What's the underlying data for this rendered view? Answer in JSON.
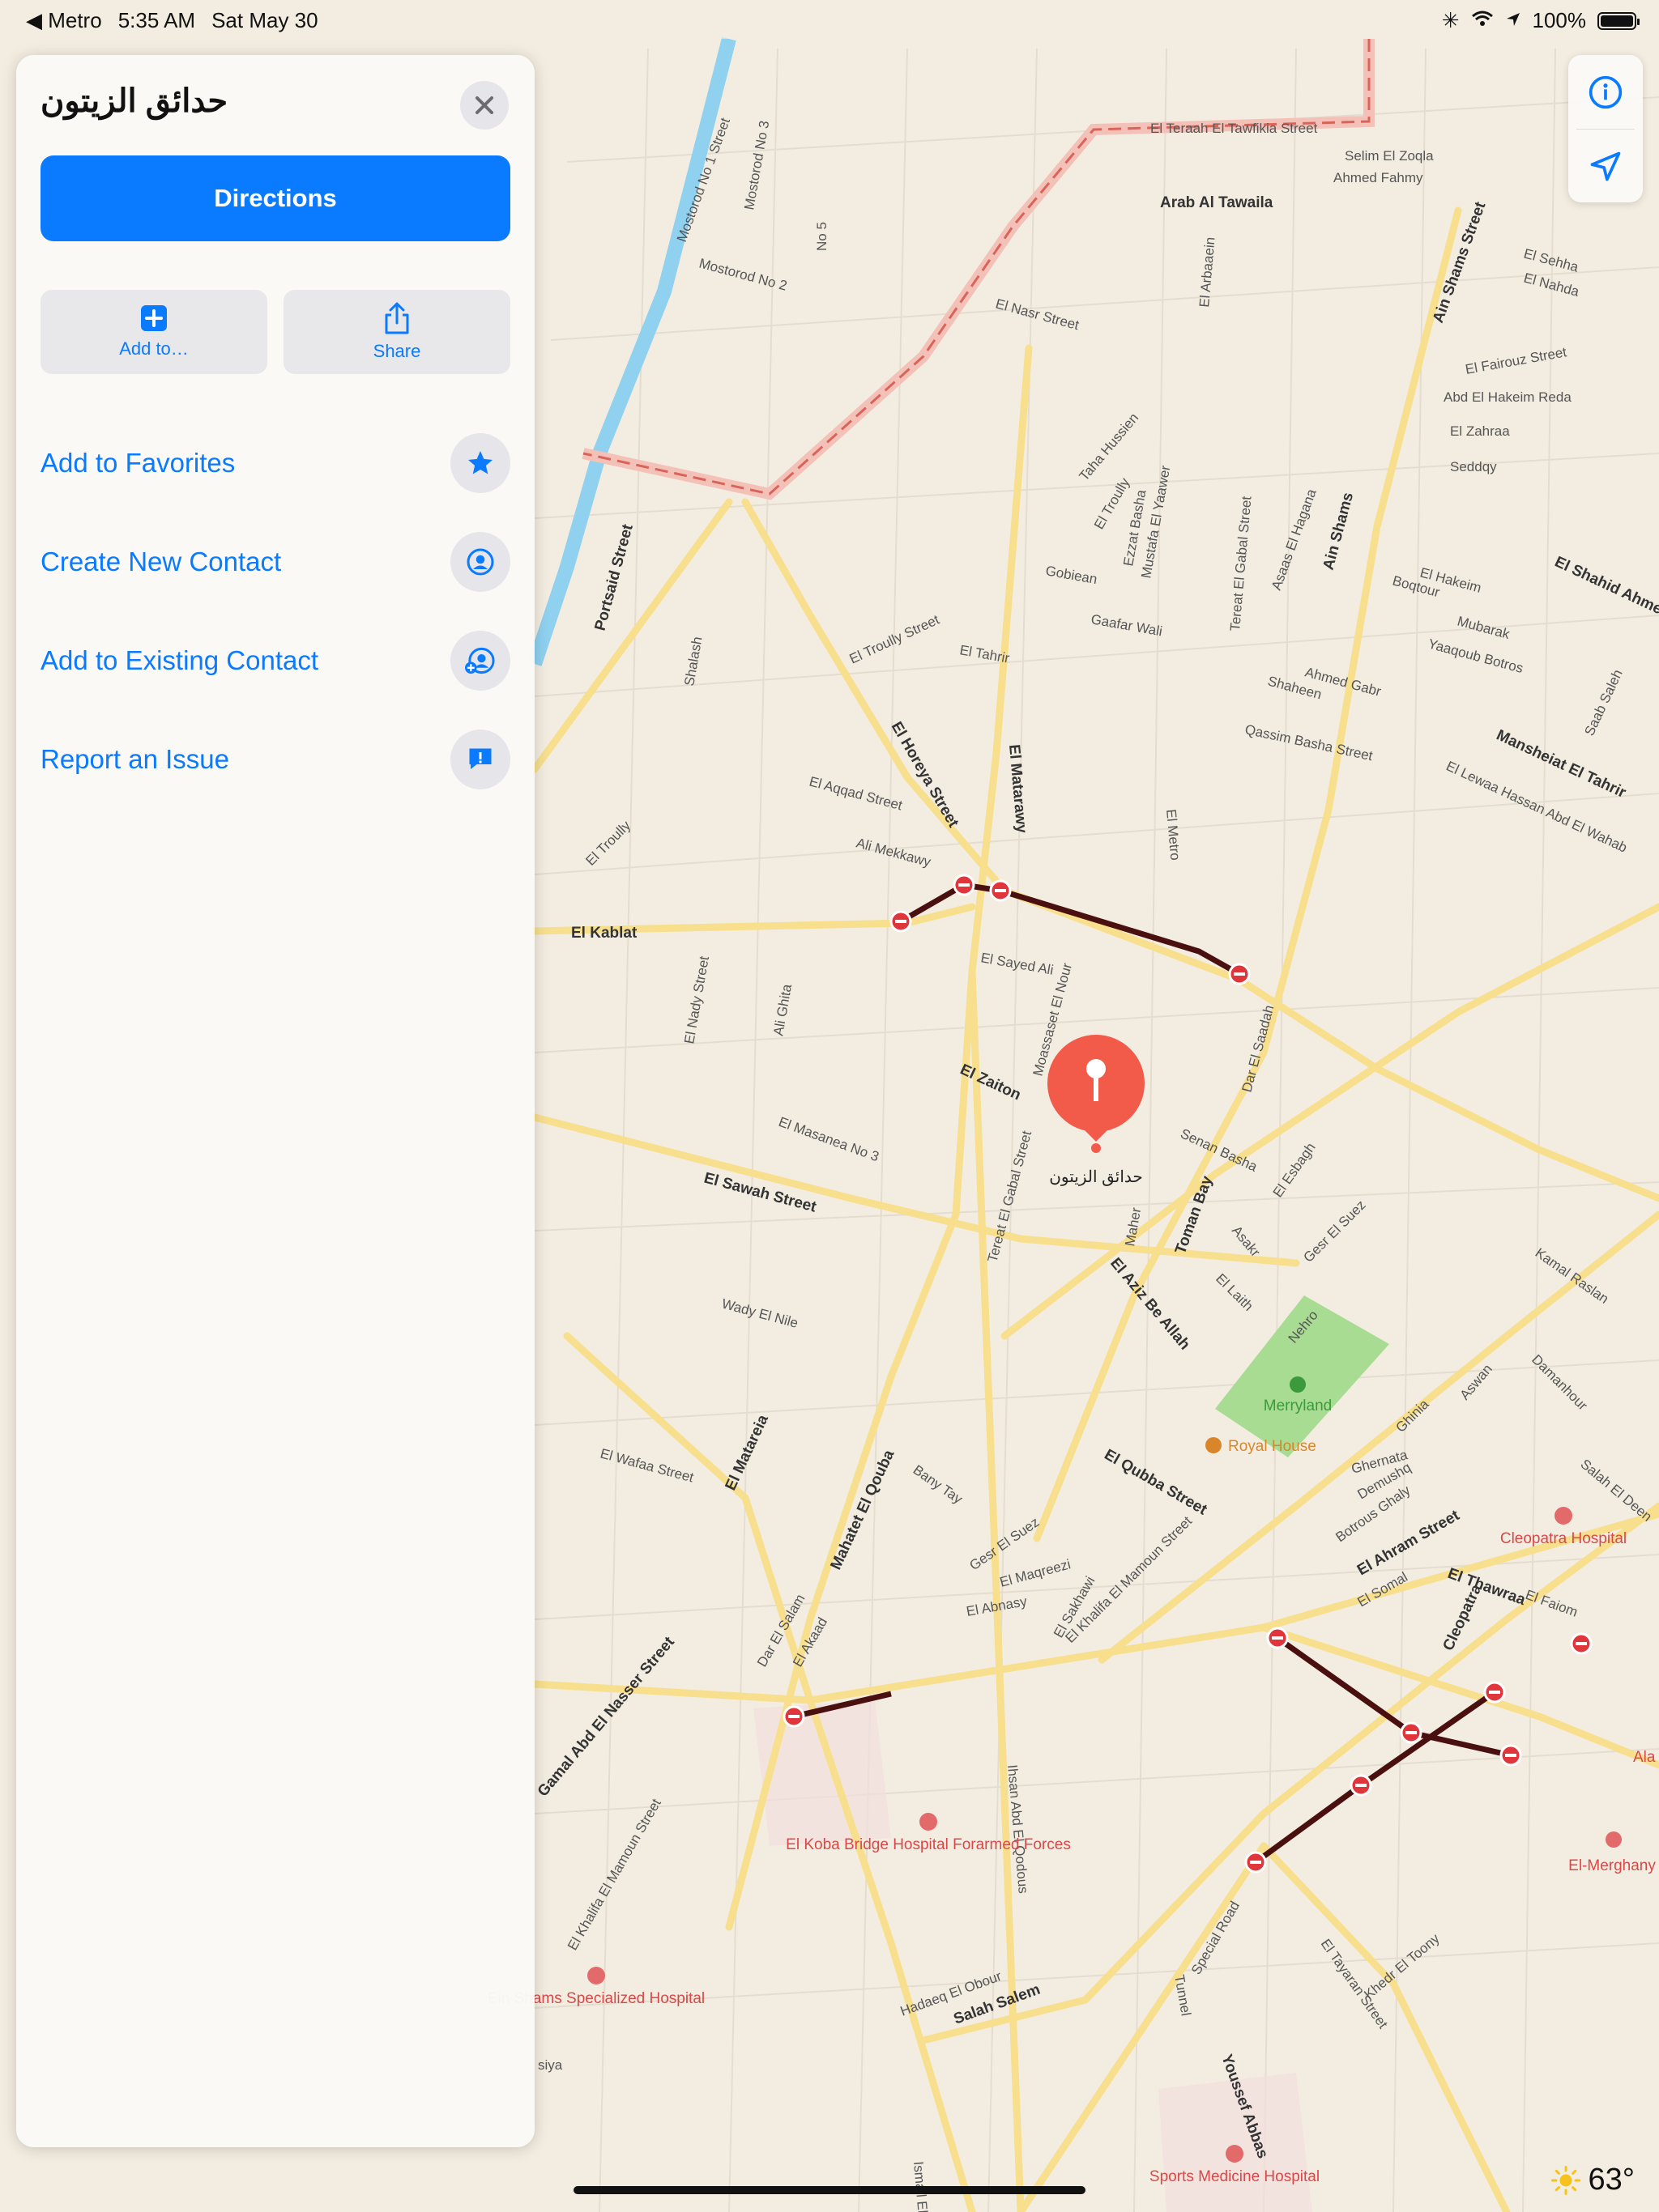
{
  "status_bar": {
    "back_label": "◀ Metro",
    "time": "5:35 AM",
    "date": "Sat May 30",
    "battery": "100%"
  },
  "panel": {
    "title": "حدائق الزيتون",
    "directions_label": "Directions",
    "add_to_label": "Add to…",
    "share_label": "Share",
    "actions": [
      {
        "label": "Add to Favorites",
        "icon": "star-icon"
      },
      {
        "label": "Create New Contact",
        "icon": "contact-icon"
      },
      {
        "label": "Add to Existing Contact",
        "icon": "add-contact-icon"
      },
      {
        "label": "Report an Issue",
        "icon": "report-icon"
      }
    ]
  },
  "map": {
    "pin_label": "حدائق الزيتون",
    "streets": [
      "El Teraah El Tawfikia Street",
      "Selim El Zoqla",
      "Ahmed Fahmy",
      "Arab Al Tawaila",
      "Mostorod No 1 Street",
      "Mostorod No 2",
      "Mostorod No 3",
      "No 5",
      "El Nasr Street",
      "El Arbaaein",
      "Ain Shams Street",
      "El Sehha",
      "El Nahda",
      "El Fairouz Street",
      "Abd El Hakeim Reda",
      "El Zahraa",
      "Seddqy",
      "Portsaid Street",
      "Taha Hussien",
      "El Troully",
      "Ezzat Basha",
      "Mustafa El Yaawer",
      "Tereat El Gabal Street",
      "Asaas El Hagana",
      "Ain Shams",
      "Gobiean",
      "Gaafar Wali",
      "El Troully Street",
      "El Tahrir",
      "El Hakeim",
      "Boqtour",
      "Mubarak",
      "Yaaqoub Botros",
      "Ahmed Gabr",
      "Shaheen",
      "Qassim Basha Street",
      "Mansheiat El Tahrir",
      "El Lewaa Hassan Abd El Wahab",
      "El Shahid Ahmed",
      "Saab Saleh",
      "Shalash",
      "El Horeya Street",
      "El Matarawy",
      "El Aqqad Street",
      "Ali Mekkawy",
      "El Troully",
      "El Kablat",
      "El Metro",
      "El Sayed Ali",
      "El Nady Street",
      "Ali Ghita",
      "Moassaset El Nour",
      "Dar El Saadah",
      "El Zaiton",
      "El Masanea No 3",
      "Senan Basha",
      "El Esbagh",
      "El Sawah Street",
      "Tereat El Gabal Street",
      "Maher",
      "Toman Bay",
      "Asakr",
      "El Aziz Be Allah",
      "El Laith",
      "Gesr El Suez",
      "Kamal Raslan",
      "Wady El Nile",
      "Nehro",
      "Aswan",
      "Damanhour",
      "El Wafaa Street",
      "El Matareia",
      "Ghinia",
      "Ghernata",
      "Demushq",
      "Botrous Ghaly",
      "El Ahram Street",
      "El Qubba Street",
      "Bany Tay",
      "Mahatet El Qouba",
      "Gesr El Suez",
      "El Maqreezi",
      "El Abnasy",
      "Dar El Salam",
      "El Akaad",
      "El Sakhawi",
      "El Khalifa El Mamoun Street",
      "El Somal",
      "El Thawraa",
      "Cleopatra",
      "El Faiom",
      "Salah El Deen",
      "Ihsan Abd El Qodous",
      "El Khalifa El Mamoun Street",
      "Gamal Abd El Nasser Street",
      "Hadaeq El Obour",
      "Salah Salem",
      "Special Road",
      "Tunnel",
      "El Tayaran Street",
      "Khedr El Toony",
      "Youssef Abbas",
      "Ismail El",
      "siya"
    ],
    "pois": {
      "park": "Merryland",
      "restaurant": "Royal House",
      "hospital_1": "Cleopatra Hospital",
      "hospital_2": "El Koba Bridge Hospital Forarmed Forces",
      "hospital_3": "Ein Shams Specialized Hospital",
      "hospital_4": "Sports Medicine Hospital",
      "place_1": "El-Merghany",
      "place_2": "Ala No"
    }
  },
  "weather": {
    "temperature": "63°",
    "icon": "sun-icon"
  },
  "colors": {
    "accent": "#0a7aff",
    "pin": "#f25a4a",
    "map_bg": "#f3ede1",
    "road": "#fae9a8",
    "water": "#8fd1ef",
    "park": "#a8dc92"
  }
}
